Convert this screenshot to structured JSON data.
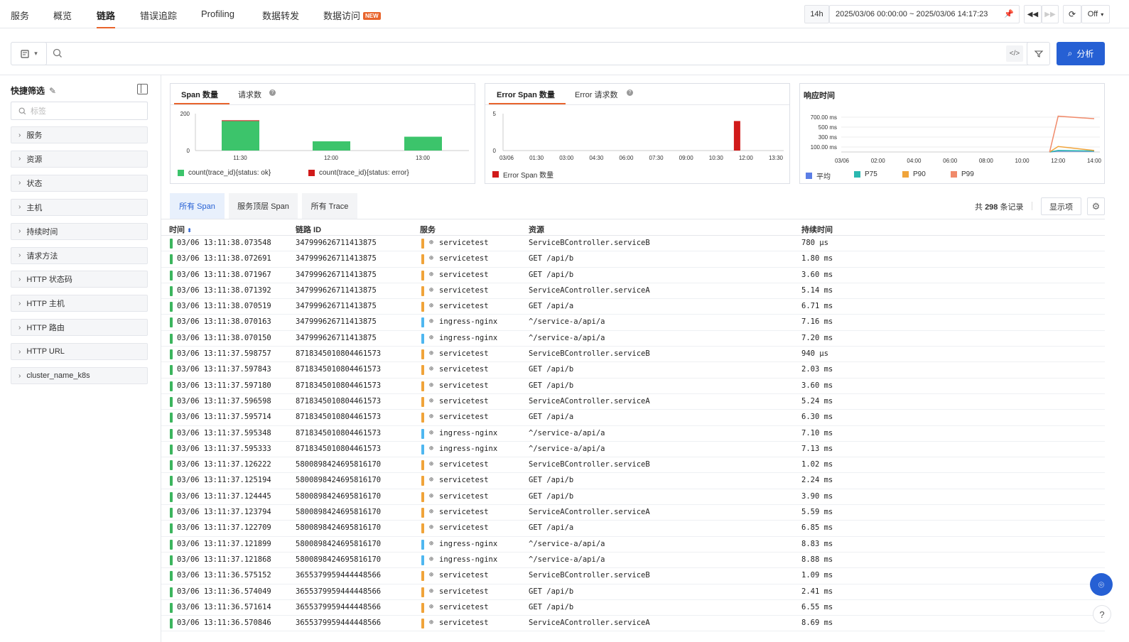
{
  "nav": {
    "tabs": [
      {
        "label": "服务"
      },
      {
        "label": "概览"
      },
      {
        "label": "链路"
      },
      {
        "label": "错误追踪"
      },
      {
        "label": "Profiling"
      },
      {
        "label": "数据转发"
      },
      {
        "label": "数据访问"
      }
    ],
    "active": "链路",
    "new_badge": "NEW"
  },
  "time": {
    "preset": "14h",
    "range": "2025/03/06 00:00:00 ~ 2025/03/06 14:17:23",
    "refresh": "Off"
  },
  "search": {
    "placeholder": "",
    "analyze_label": "分析"
  },
  "sidebar": {
    "title": "快捷筛选",
    "search_placeholder": "标签",
    "filters": [
      "服务",
      "资源",
      "状态",
      "主机",
      "持续时间",
      "请求方法",
      "HTTP 状态码",
      "HTTP 主机",
      "HTTP 路由",
      "HTTP URL",
      "cluster_name_k8s"
    ]
  },
  "charts": {
    "span": {
      "tab_active": "Span 数量",
      "tab_other": "请求数",
      "legend_ok": "count(trace_id){status: ok}",
      "legend_error": "count(trace_id){status: error}",
      "color_ok": "#3cc46b",
      "color_error": "#d11a1a"
    },
    "error": {
      "tab_active": "Error Span 数量",
      "tab_other": "Error 请求数",
      "legend": "Error Span 数量",
      "color": "#d11a1a"
    },
    "latency": {
      "title": "响应时间",
      "legend": [
        {
          "name": "平均",
          "color": "#5b7ee5"
        },
        {
          "name": "P75",
          "color": "#2ab8b0"
        },
        {
          "name": "P90",
          "color": "#f0a43a"
        },
        {
          "name": "P99",
          "color": "#f08a6a"
        }
      ]
    }
  },
  "chart_data": [
    {
      "type": "bar",
      "categories": [
        "11:30",
        "12:00",
        "13:00"
      ],
      "series": [
        {
          "name": "count(trace_id){status: ok}",
          "values": [
            160,
            50,
            75
          ]
        },
        {
          "name": "count(trace_id){status: error}",
          "values": [
            4,
            0,
            0
          ]
        }
      ],
      "yticks": [
        "200",
        "0"
      ],
      "ylim": [
        0,
        200
      ]
    },
    {
      "type": "bar",
      "categories": [
        "03/06",
        "01:30",
        "03:00",
        "04:30",
        "06:00",
        "07:30",
        "09:00",
        "10:30",
        "12:00",
        "13:30"
      ],
      "series": [
        {
          "name": "Error Span 数量",
          "values": [
            0,
            0,
            0,
            0,
            0,
            0,
            0,
            0,
            4,
            0
          ]
        }
      ],
      "yticks": [
        "5",
        "0"
      ],
      "ylim": [
        0,
        5
      ]
    },
    {
      "type": "line",
      "x": [
        "03/06",
        "02:00",
        "04:00",
        "06:00",
        "08:00",
        "10:00",
        "12:00",
        "14:00"
      ],
      "yticks": [
        "700.00 ms",
        "500 ms",
        "300 ms",
        "100.00 ms"
      ],
      "ylim": [
        0,
        800
      ],
      "series": [
        {
          "name": "平均",
          "values": [
            null,
            null,
            null,
            null,
            null,
            null,
            20,
            15
          ]
        },
        {
          "name": "P75",
          "values": [
            null,
            null,
            null,
            null,
            null,
            null,
            30,
            20
          ]
        },
        {
          "name": "P90",
          "values": [
            null,
            null,
            null,
            null,
            null,
            null,
            110,
            30
          ]
        },
        {
          "name": "P99",
          "values": [
            null,
            null,
            null,
            null,
            null,
            null,
            720,
            670
          ]
        }
      ]
    }
  ],
  "span_tabs": [
    "所有 Span",
    "服务顶层 Span",
    "所有 Trace"
  ],
  "summary": {
    "prefix": "共",
    "count": "298",
    "suffix": "条记录"
  },
  "display_label": "显示项",
  "table": {
    "columns": [
      "时间",
      "链路 ID",
      "服务",
      "资源",
      "持续时间"
    ],
    "rows": [
      [
        "03/06 13:11:38.073548",
        "347999626711413875",
        "servicetest",
        "ServiceBController.serviceB",
        "780 μs"
      ],
      [
        "03/06 13:11:38.072691",
        "347999626711413875",
        "servicetest",
        "GET /api/b",
        "1.80 ms"
      ],
      [
        "03/06 13:11:38.071967",
        "347999626711413875",
        "servicetest",
        "GET /api/b",
        "3.60 ms"
      ],
      [
        "03/06 13:11:38.071392",
        "347999626711413875",
        "servicetest",
        "ServiceAController.serviceA",
        "5.14 ms"
      ],
      [
        "03/06 13:11:38.070519",
        "347999626711413875",
        "servicetest",
        "GET /api/a",
        "6.71 ms"
      ],
      [
        "03/06 13:11:38.070163",
        "347999626711413875",
        "ingress-nginx",
        "^/service-a/api/a",
        "7.16 ms"
      ],
      [
        "03/06 13:11:38.070150",
        "347999626711413875",
        "ingress-nginx",
        "^/service-a/api/a",
        "7.20 ms"
      ],
      [
        "03/06 13:11:37.598757",
        "8718345010804461573",
        "servicetest",
        "ServiceBController.serviceB",
        "940 μs"
      ],
      [
        "03/06 13:11:37.597843",
        "8718345010804461573",
        "servicetest",
        "GET /api/b",
        "2.03 ms"
      ],
      [
        "03/06 13:11:37.597180",
        "8718345010804461573",
        "servicetest",
        "GET /api/b",
        "3.60 ms"
      ],
      [
        "03/06 13:11:37.596598",
        "8718345010804461573",
        "servicetest",
        "ServiceAController.serviceA",
        "5.24 ms"
      ],
      [
        "03/06 13:11:37.595714",
        "8718345010804461573",
        "servicetest",
        "GET /api/a",
        "6.30 ms"
      ],
      [
        "03/06 13:11:37.595348",
        "8718345010804461573",
        "ingress-nginx",
        "^/service-a/api/a",
        "7.10 ms"
      ],
      [
        "03/06 13:11:37.595333",
        "8718345010804461573",
        "ingress-nginx",
        "^/service-a/api/a",
        "7.13 ms"
      ],
      [
        "03/06 13:11:37.126222",
        "5800898424695816170",
        "servicetest",
        "ServiceBController.serviceB",
        "1.02 ms"
      ],
      [
        "03/06 13:11:37.125194",
        "5800898424695816170",
        "servicetest",
        "GET /api/b",
        "2.24 ms"
      ],
      [
        "03/06 13:11:37.124445",
        "5800898424695816170",
        "servicetest",
        "GET /api/b",
        "3.90 ms"
      ],
      [
        "03/06 13:11:37.123794",
        "5800898424695816170",
        "servicetest",
        "ServiceAController.serviceA",
        "5.59 ms"
      ],
      [
        "03/06 13:11:37.122709",
        "5800898424695816170",
        "servicetest",
        "GET /api/a",
        "6.85 ms"
      ],
      [
        "03/06 13:11:37.121899",
        "5800898424695816170",
        "ingress-nginx",
        "^/service-a/api/a",
        "8.83 ms"
      ],
      [
        "03/06 13:11:37.121868",
        "5800898424695816170",
        "ingress-nginx",
        "^/service-a/api/a",
        "8.88 ms"
      ],
      [
        "03/06 13:11:36.575152",
        "3655379959444448566",
        "servicetest",
        "ServiceBController.serviceB",
        "1.09 ms"
      ],
      [
        "03/06 13:11:36.574049",
        "3655379959444448566",
        "servicetest",
        "GET /api/b",
        "2.41 ms"
      ],
      [
        "03/06 13:11:36.571614",
        "3655379959444448566",
        "servicetest",
        "GET /api/b",
        "6.55 ms"
      ],
      [
        "03/06 13:11:36.570846",
        "3655379959444448566",
        "servicetest",
        "ServiceAController.serviceA",
        "8.69 ms"
      ]
    ],
    "service_colors": {
      "servicetest": "#f0a43a",
      "ingress-nginx": "#4fb7f0"
    }
  }
}
